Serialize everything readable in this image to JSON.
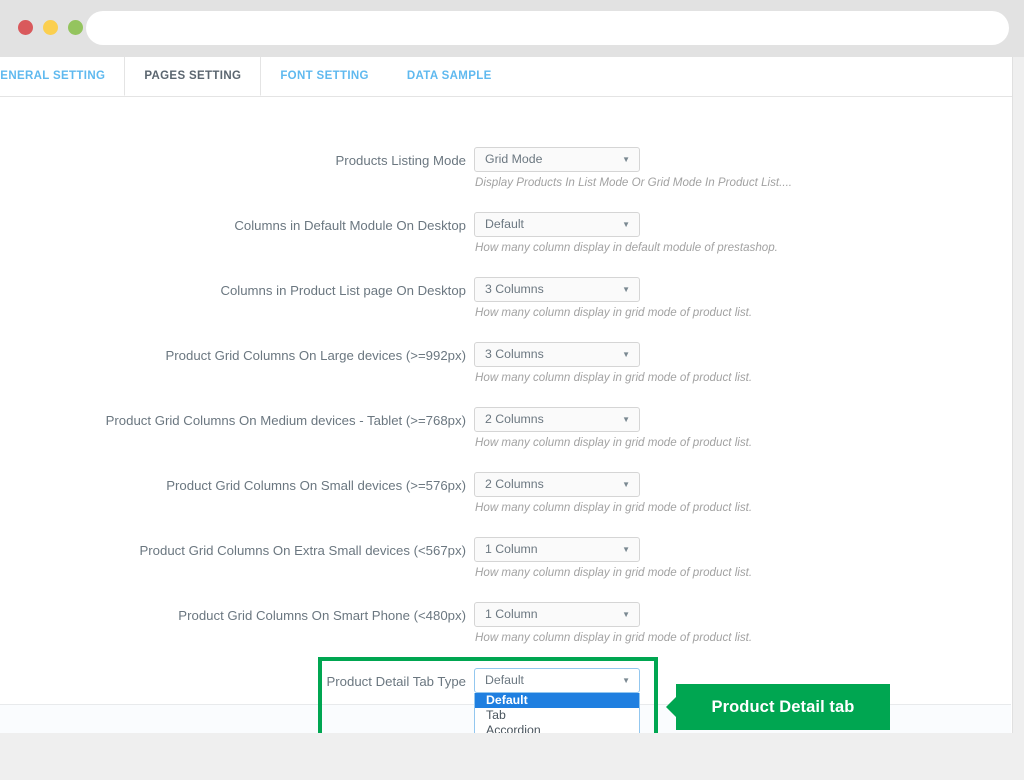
{
  "browser": {
    "traffic_lights": [
      {
        "name": "close-dot",
        "color": "#d9595c"
      },
      {
        "name": "minimize-dot",
        "color": "#fbcf4f"
      },
      {
        "name": "maximize-dot",
        "color": "#94c45e"
      }
    ],
    "address_bar_value": "",
    "address_bar_placeholder": ""
  },
  "tabs": [
    {
      "label": "GENERAL SETTING",
      "active": false
    },
    {
      "label": "PAGES SETTING",
      "active": true
    },
    {
      "label": "FONT SETTING",
      "active": false
    },
    {
      "label": "DATA SAMPLE",
      "active": false
    }
  ],
  "form": {
    "rows": [
      {
        "label": "Products Listing Mode",
        "value": "Grid Mode",
        "help": "Display Products In List Mode Or Grid Mode In Product List...."
      },
      {
        "label": "Columns in Default Module On Desktop",
        "value": "Default",
        "help": "How many column display in default module of prestashop."
      },
      {
        "label": "Columns in Product List page On Desktop",
        "value": "3 Columns",
        "help": "How many column display in grid mode of product list."
      },
      {
        "label": "Product Grid Columns On Large devices (>=992px)",
        "value": "3 Columns",
        "help": "How many column display in grid mode of product list."
      },
      {
        "label": "Product Grid Columns On Medium devices - Tablet (>=768px)",
        "value": "2 Columns",
        "help": "How many column display in grid mode of product list."
      },
      {
        "label": "Product Grid Columns On Small devices (>=576px)",
        "value": "2 Columns",
        "help": "How many column display in grid mode of product list."
      },
      {
        "label": "Product Grid Columns On Extra Small devices (<567px)",
        "value": "1 Column",
        "help": "How many column display in grid mode of product list."
      },
      {
        "label": "Product Grid Columns On Smart Phone (<480px)",
        "value": "1 Column",
        "help": "How many column display in grid mode of product list."
      }
    ],
    "detail_tab_row": {
      "label": "Product Detail Tab Type",
      "value": "Default",
      "options": [
        {
          "label": "Default",
          "selected": true
        },
        {
          "label": "Tab",
          "selected": false
        },
        {
          "label": "Accordion",
          "selected": false
        }
      ]
    }
  },
  "annotation": {
    "callout_label": "Product Detail tab",
    "accent_color": "#00a651"
  },
  "icons": {
    "caret": "▼"
  }
}
